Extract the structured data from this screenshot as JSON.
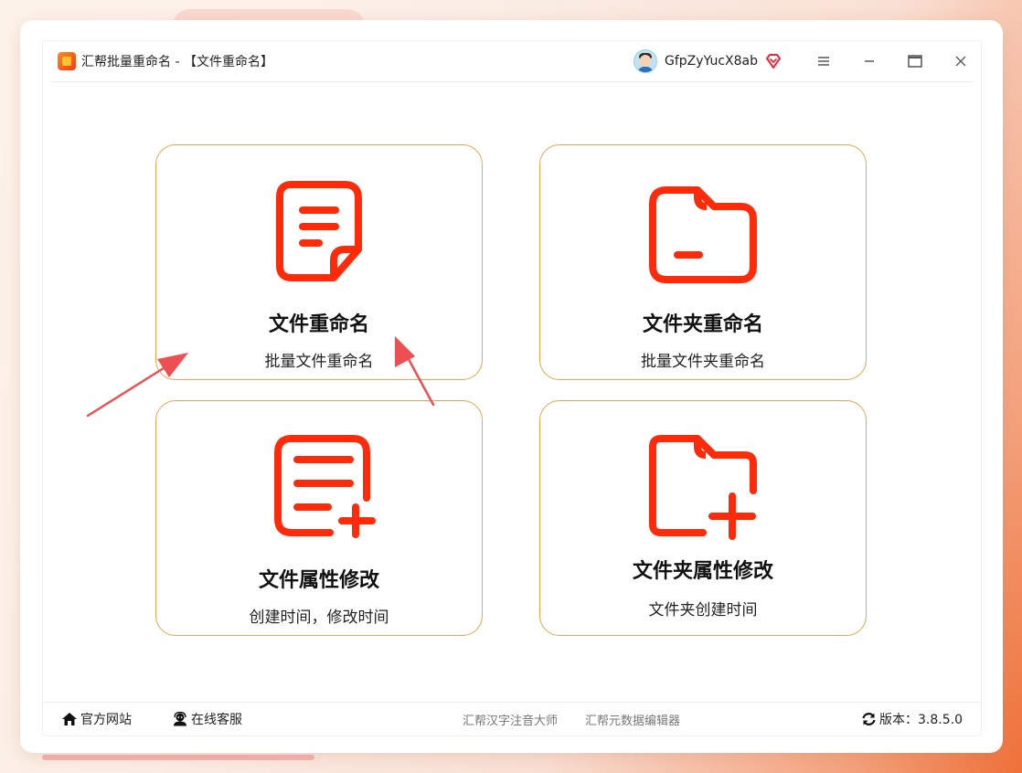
{
  "window": {
    "title": "汇帮批量重命名 - 【文件重命名】",
    "username": "GfpZyYucX8ab"
  },
  "cards": [
    {
      "title": "文件重命名",
      "subtitle": "批量文件重命名",
      "icon": "document-icon"
    },
    {
      "title": "文件夹重命名",
      "subtitle": "批量文件夹重命名",
      "icon": "folder-icon"
    },
    {
      "title": "文件属性修改",
      "subtitle": "创建时间，修改时间",
      "icon": "document-plus-icon"
    },
    {
      "title": "文件夹属性修改",
      "subtitle": "文件夹创建时间",
      "icon": "folder-plus-icon"
    }
  ],
  "footer": {
    "official_site": "官方网站",
    "online_service": "在线客服",
    "link1": "汇帮汉字注音大师",
    "link2": "汇帮元数据编辑器",
    "version": "版本：3.8.5.0"
  },
  "colors": {
    "accent": "#ff2a0a",
    "card_border": "#f0a24a",
    "annotation_arrow": "#ef4f52"
  }
}
